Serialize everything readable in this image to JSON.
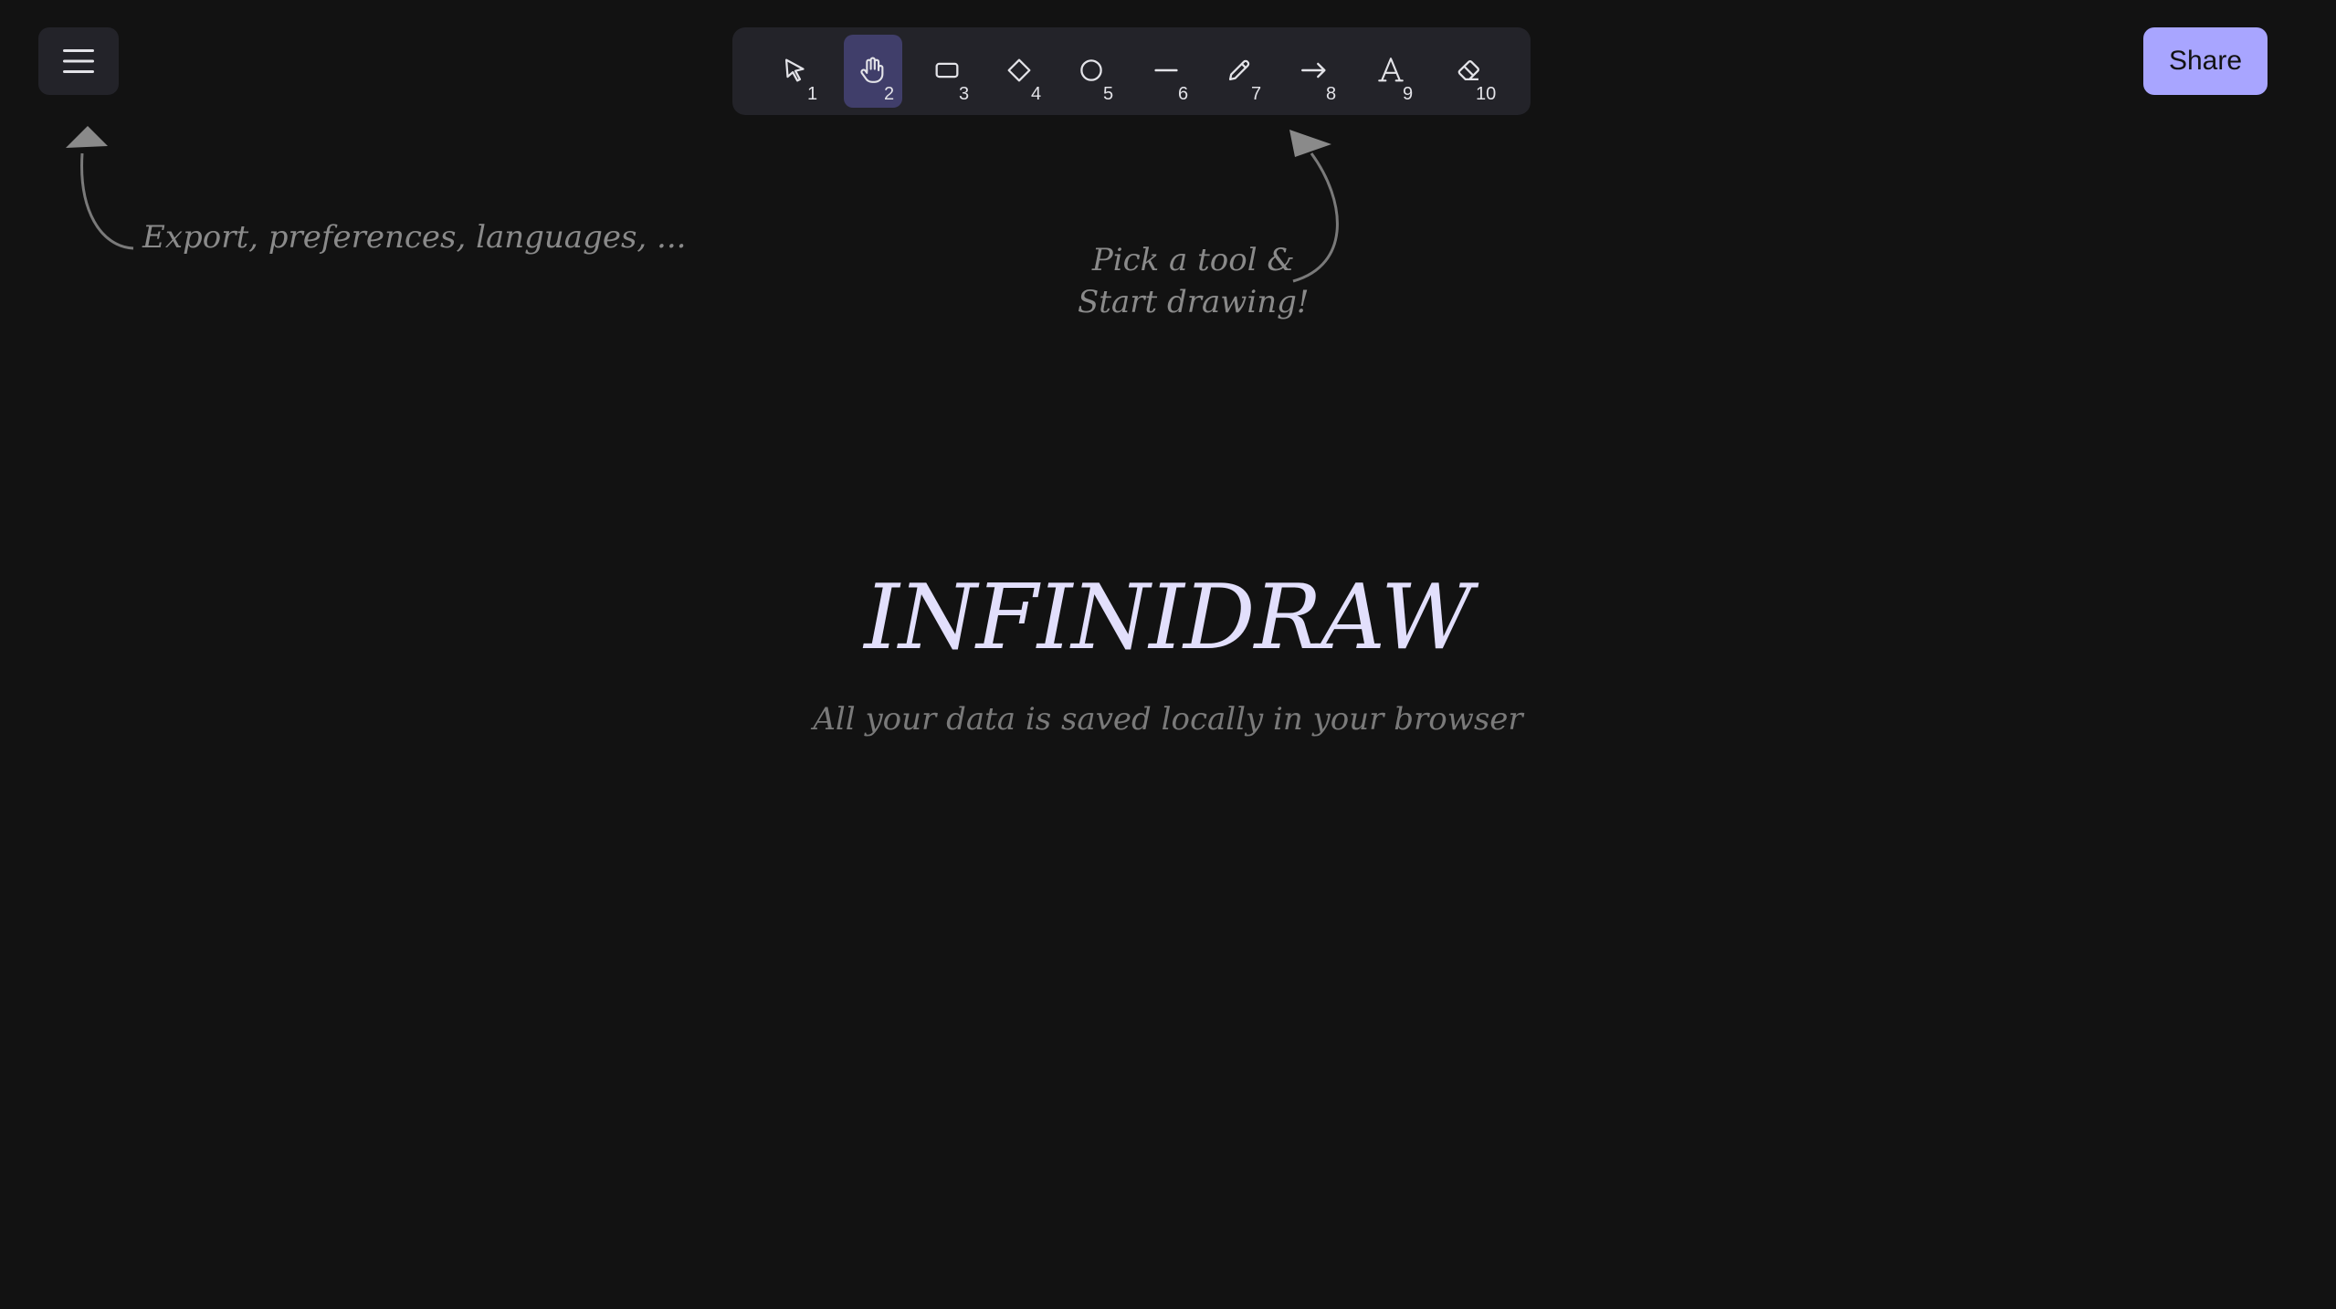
{
  "menu": {
    "icon": "hamburger-menu-icon"
  },
  "toolbar": {
    "active_tool": 2,
    "tools": [
      {
        "key": "1",
        "icon": "select-pointer-icon"
      },
      {
        "key": "2",
        "icon": "hand-pan-icon"
      },
      {
        "key": "3",
        "icon": "rectangle-icon"
      },
      {
        "key": "4",
        "icon": "diamond-icon"
      },
      {
        "key": "5",
        "icon": "ellipse-icon"
      },
      {
        "key": "6",
        "icon": "line-icon"
      },
      {
        "key": "7",
        "icon": "pencil-icon"
      },
      {
        "key": "8",
        "icon": "arrow-icon"
      },
      {
        "key": "9",
        "icon": "text-icon"
      },
      {
        "key": "10",
        "icon": "eraser-icon"
      }
    ]
  },
  "share": {
    "label": "Share"
  },
  "hints": {
    "menu": "Export, preferences, languages, ...",
    "tool_line1": "Pick a tool &",
    "tool_line2": "Start drawing!"
  },
  "welcome": {
    "title": "INFINIDRAW",
    "subtitle": "All your data is saved locally in your browser"
  },
  "colors": {
    "background": "#121212",
    "panel": "#232329",
    "accent": "#a8a5ff",
    "active_tool": "#403e6a"
  }
}
